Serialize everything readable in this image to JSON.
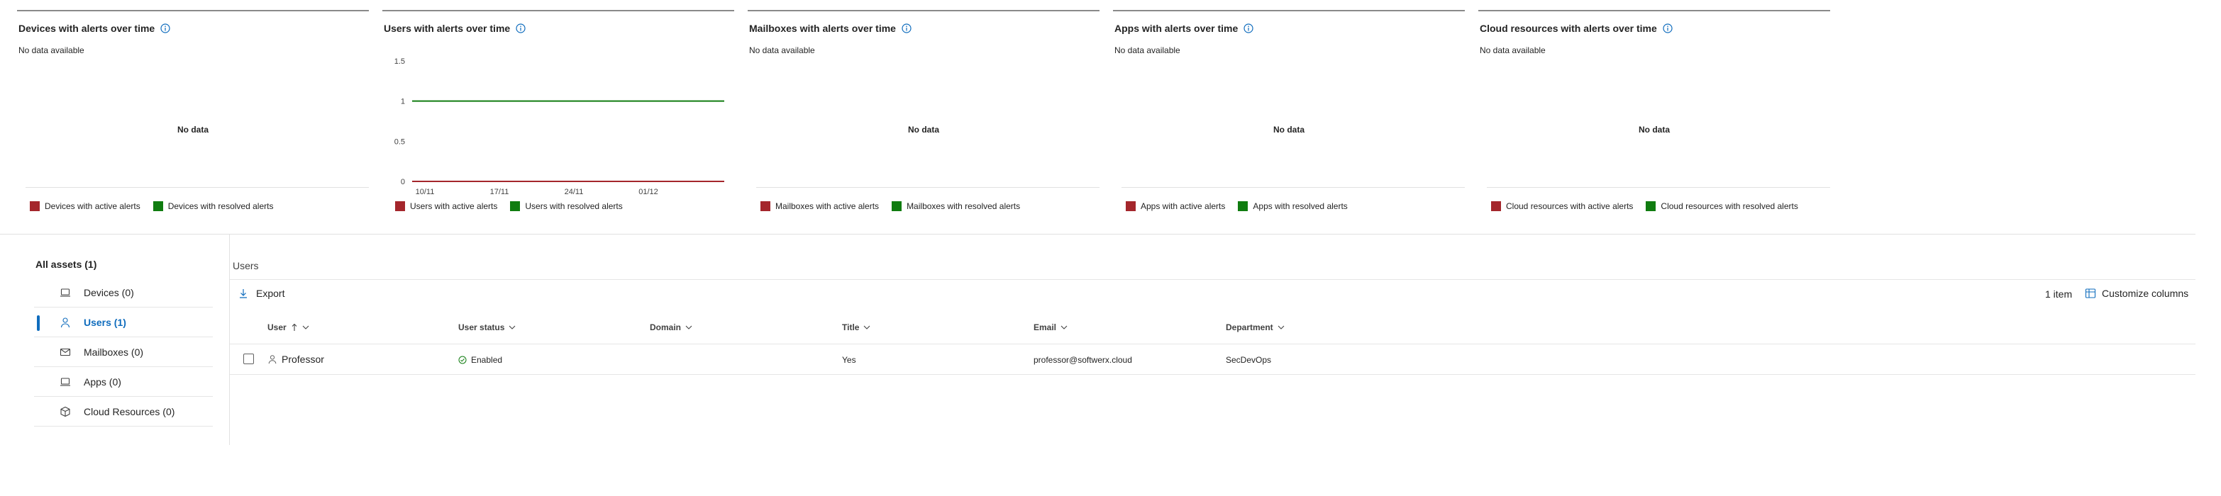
{
  "cards": [
    {
      "title": "Devices with alerts over time",
      "no_data_text": "No data available",
      "center_text": "No data",
      "legend": [
        "Devices with active alerts",
        "Devices with resolved alerts"
      ]
    },
    {
      "title": "Users with alerts over time",
      "legend": [
        "Users with active alerts",
        "Users with resolved alerts"
      ]
    },
    {
      "title": "Mailboxes with alerts over time",
      "no_data_text": "No data available",
      "center_text": "No data",
      "legend": [
        "Mailboxes with active alerts",
        "Mailboxes with resolved alerts"
      ]
    },
    {
      "title": "Apps with alerts over time",
      "no_data_text": "No data available",
      "center_text": "No data",
      "legend": [
        "Apps with active alerts",
        "Apps with resolved alerts"
      ]
    },
    {
      "title": "Cloud resources with alerts over time",
      "no_data_text": "No data available",
      "center_text": "No data",
      "legend": [
        "Cloud resources with active alerts",
        "Cloud resources with resolved alerts"
      ]
    }
  ],
  "colors": {
    "active": "#a4262c",
    "resolved": "#107c10",
    "accent": "#0f6cbd"
  },
  "chart_data": {
    "type": "line",
    "x": [
      "10/11",
      "17/11",
      "24/11",
      "01/12"
    ],
    "ylim": [
      0,
      1.5
    ],
    "yticks": [
      "1.5",
      "1",
      "0.5",
      "0"
    ],
    "series": [
      {
        "name": "Users with active alerts",
        "values": [
          0,
          0,
          0,
          0
        ]
      },
      {
        "name": "Users with resolved alerts",
        "values": [
          1,
          1,
          1,
          1
        ]
      }
    ]
  },
  "nav": {
    "title": "All assets (1)",
    "items": [
      {
        "label": "Devices (0)",
        "icon": "laptop-icon"
      },
      {
        "label": "Users (1)",
        "icon": "user-icon",
        "active": true
      },
      {
        "label": "Mailboxes (0)",
        "icon": "mail-icon"
      },
      {
        "label": "Apps (0)",
        "icon": "app-icon"
      },
      {
        "label": "Cloud Resources (0)",
        "icon": "cube-icon"
      }
    ]
  },
  "main": {
    "section_label": "Users",
    "export_label": "Export",
    "item_count": "1 item",
    "customize_label": "Customize columns"
  },
  "table": {
    "columns": [
      "User",
      "User status",
      "Domain",
      "Title",
      "Email",
      "Department"
    ],
    "rows": [
      {
        "user": "Professor",
        "status": "Enabled",
        "domain": "",
        "title": "Yes",
        "email": "professor@softwerx.cloud",
        "department": "SecDevOps"
      }
    ]
  }
}
